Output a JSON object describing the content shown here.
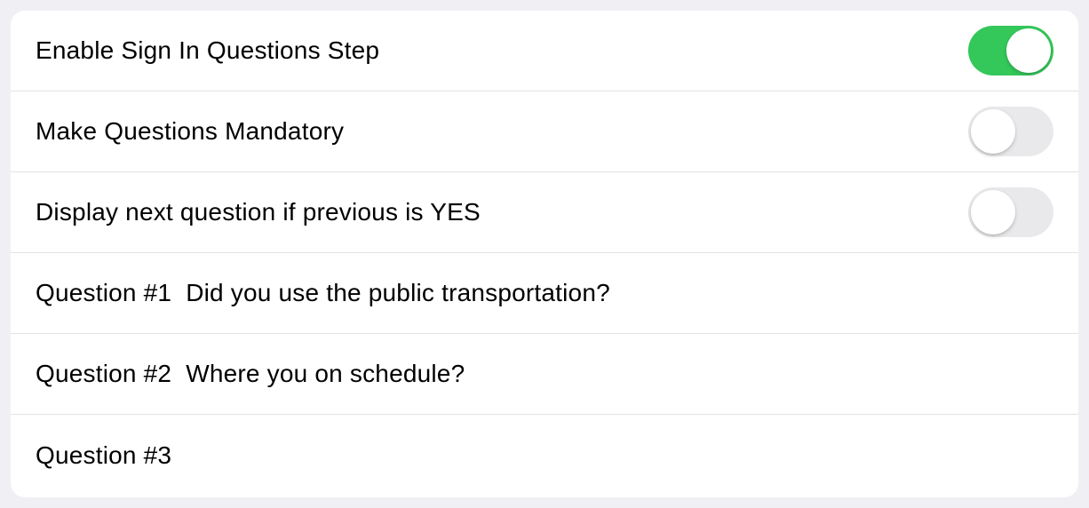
{
  "settings": [
    {
      "label": "Enable Sign In Questions Step",
      "enabled": true
    },
    {
      "label": "Make Questions Mandatory",
      "enabled": false
    },
    {
      "label": "Display next question if previous is YES",
      "enabled": false
    }
  ],
  "questions": [
    {
      "prefix": "Question #1",
      "text": "Did you use the public transportation?"
    },
    {
      "prefix": "Question #2",
      "text": "Where you on schedule?"
    },
    {
      "prefix": "Question #3",
      "text": ""
    }
  ]
}
